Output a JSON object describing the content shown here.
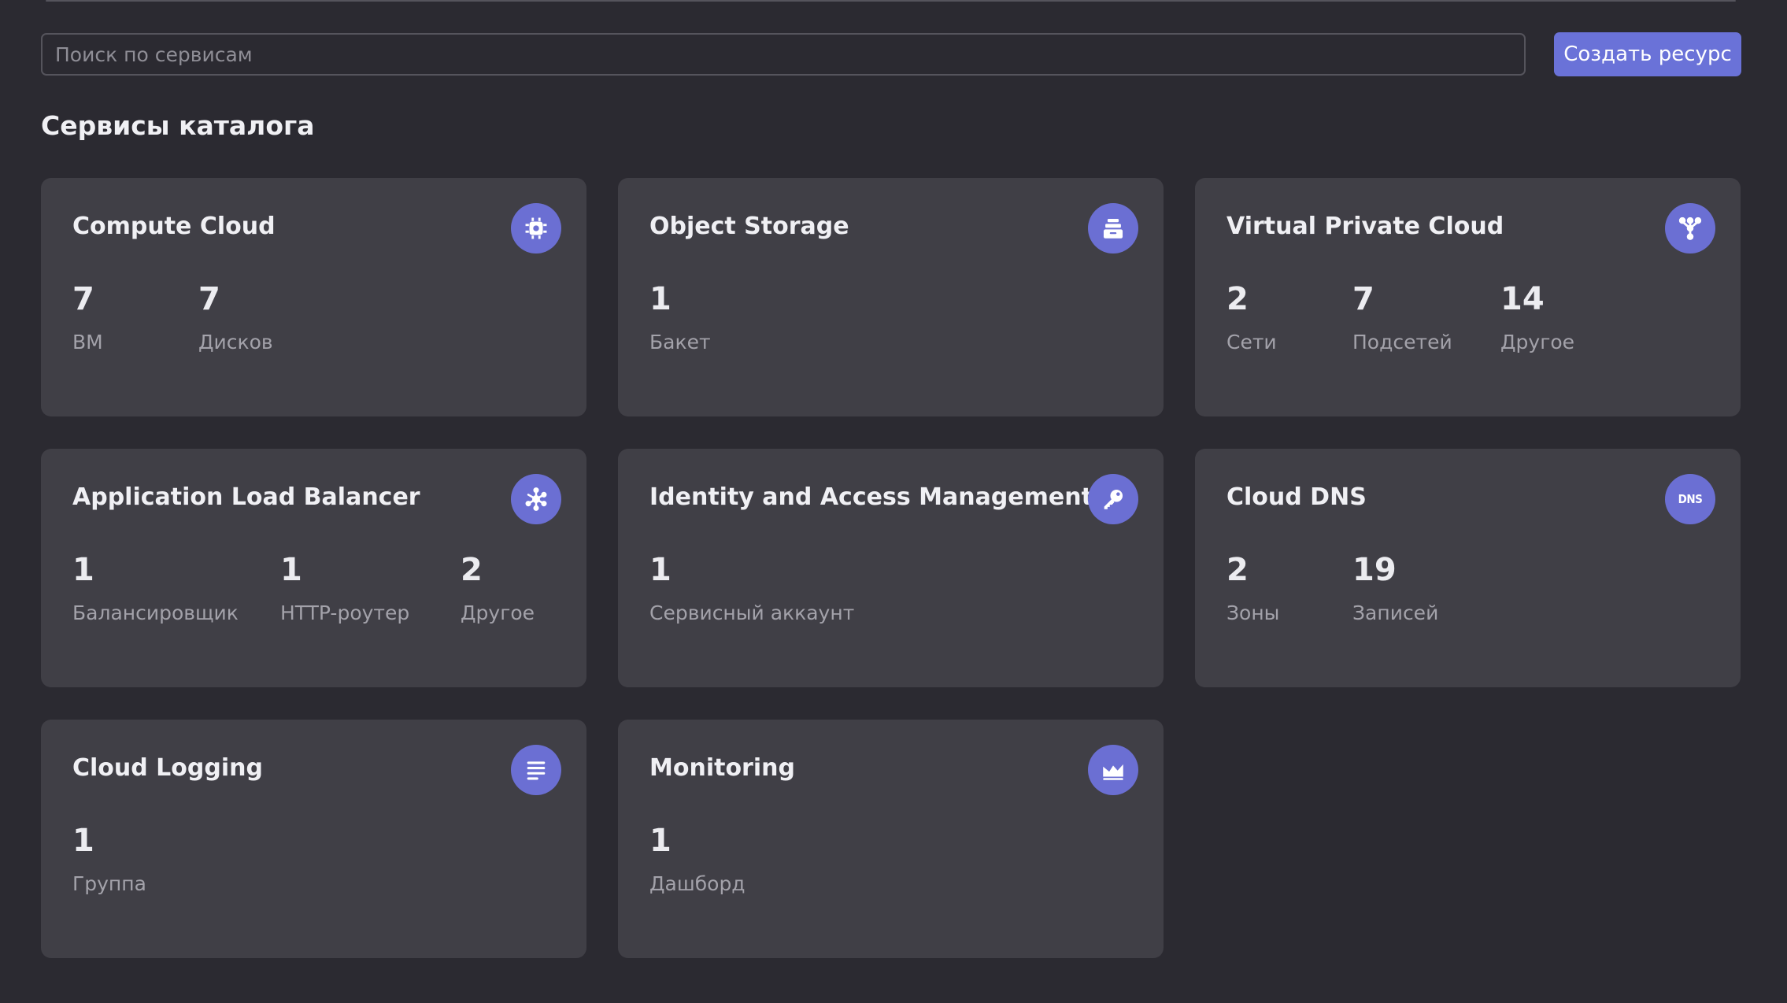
{
  "search": {
    "placeholder": "Поиск по сервисам",
    "value": ""
  },
  "create_button": {
    "label": "Создать ресурс"
  },
  "section_title": "Сервисы каталога",
  "colors": {
    "background": "#2b2a31",
    "card": "#403f46",
    "accent": "#6a72d8"
  },
  "services": [
    {
      "title": "Compute Cloud",
      "icon": "chip-icon",
      "stats": [
        {
          "value": "7",
          "label": "ВМ"
        },
        {
          "value": "7",
          "label": "Дисков"
        }
      ]
    },
    {
      "title": "Object Storage",
      "icon": "storage-icon",
      "stats": [
        {
          "value": "1",
          "label": "Бакет"
        }
      ]
    },
    {
      "title": "Virtual Private Cloud",
      "icon": "network-icon",
      "stats": [
        {
          "value": "2",
          "label": "Сети"
        },
        {
          "value": "7",
          "label": "Подсетей"
        },
        {
          "value": "14",
          "label": "Другое"
        }
      ]
    },
    {
      "title": "Application Load Balancer",
      "icon": "balancer-icon",
      "stats": [
        {
          "value": "1",
          "label": "Балансировщик"
        },
        {
          "value": "1",
          "label": "HTTP-роутер"
        },
        {
          "value": "2",
          "label": "Другое"
        }
      ]
    },
    {
      "title": "Identity and Access Management",
      "icon": "key-icon",
      "stats": [
        {
          "value": "1",
          "label": "Сервисный аккаунт"
        }
      ]
    },
    {
      "title": "Cloud DNS",
      "icon": "dns-icon",
      "icon_text": "DNS",
      "stats": [
        {
          "value": "2",
          "label": "Зоны"
        },
        {
          "value": "19",
          "label": "Записей"
        }
      ]
    },
    {
      "title": "Cloud Logging",
      "icon": "log-lines-icon",
      "stats": [
        {
          "value": "1",
          "label": "Группа"
        }
      ]
    },
    {
      "title": "Monitoring",
      "icon": "area-chart-icon",
      "stats": [
        {
          "value": "1",
          "label": "Дашборд"
        }
      ]
    }
  ]
}
